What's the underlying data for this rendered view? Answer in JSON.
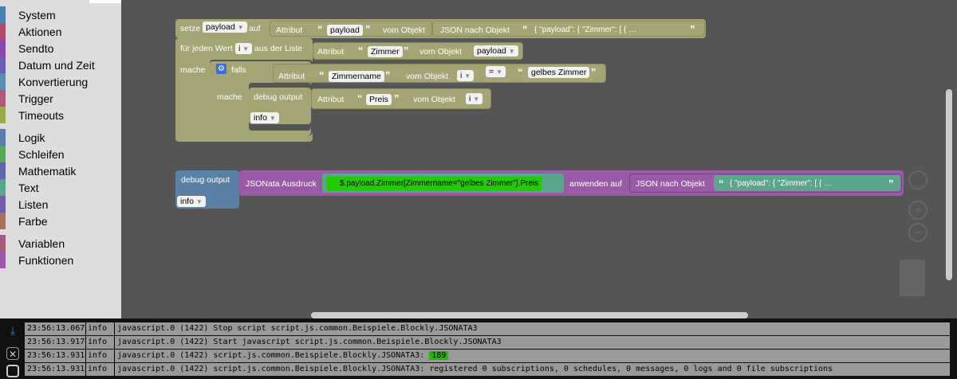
{
  "sidebar": {
    "groups1": [
      {
        "label": "System",
        "color": "#4a7fb0"
      },
      {
        "label": "Aktionen",
        "color": "#b04a6a"
      },
      {
        "label": "Sendto",
        "color": "#8a4aa8"
      },
      {
        "label": "Datum und Zeit",
        "color": "#6a5cb0"
      },
      {
        "label": "Konvertierung",
        "color": "#5a8fb0"
      },
      {
        "label": "Trigger",
        "color": "#b05a7a"
      },
      {
        "label": "Timeouts",
        "color": "#9aaa4a"
      }
    ],
    "groups2": [
      {
        "label": "Logik",
        "color": "#5b80a5"
      },
      {
        "label": "Schleifen",
        "color": "#5ba55b"
      },
      {
        "label": "Mathematik",
        "color": "#5b67a5"
      },
      {
        "label": "Text",
        "color": "#5ba58c"
      },
      {
        "label": "Listen",
        "color": "#745ba5"
      },
      {
        "label": "Farbe",
        "color": "#a5745b"
      }
    ],
    "groups3": [
      {
        "label": "Variablen",
        "color": "#a55b80"
      },
      {
        "label": "Funktionen",
        "color": "#995ba5"
      }
    ]
  },
  "blocks": {
    "set": {
      "label": "setze",
      "var": "payload",
      "auf": "auf",
      "attr": "Attribut",
      "attr_val": "payload",
      "vom": "vom Objekt",
      "json": "JSON nach Objekt",
      "json_val": "{  \"payload\": {     \"Zimmer\": [       {          …"
    },
    "foreach": {
      "label": "für jeden Wert",
      "var": "i",
      "list": "aus der Liste",
      "attr": "Attribut",
      "attr_val": "Zimmer",
      "vom": "vom Objekt",
      "obj": "payload"
    },
    "do": {
      "label": "mache"
    },
    "if": {
      "label": "falls",
      "attr": "Attribut",
      "attr_val": "Zimmername",
      "vom": "vom Objekt",
      "obj": "i",
      "op": "=",
      "val": "gelbes Zimmer"
    },
    "inner_do": {
      "label": "mache"
    },
    "debug1": {
      "label": "debug output",
      "attr": "Attribut",
      "attr_val": "Preis",
      "vom": "vom Objekt",
      "obj": "i",
      "level": "info"
    },
    "debug2": {
      "label": "debug output",
      "level": "info",
      "jsonata": "JSONata Ausdruck",
      "expr": "$.payload.Zimmer[Zimmername=\"gelbes Zimmer\"].Preis",
      "apply": "anwenden auf",
      "json": "JSON nach Objekt",
      "json_val": "{  \"payload\": {     \"Zimmer\": [       {          …"
    }
  },
  "console": {
    "rows": [
      {
        "time": "23:56:13.067",
        "level": "info",
        "msg": "javascript.0 (1422) Stop script script.js.common.Beispiele.Blockly.JSONATA3"
      },
      {
        "time": "23:56:13.917",
        "level": "info",
        "msg": "javascript.0 (1422) Start javascript script.js.common.Beispiele.Blockly.JSONATA3"
      },
      {
        "time": "23:56:13.931",
        "level": "info",
        "msg": "javascript.0 (1422) script.js.common.Beispiele.Blockly.JSONATA3: ",
        "hl": "189"
      },
      {
        "time": "23:56:13.931",
        "level": "info",
        "msg": "javascript.0 (1422) script.js.common.Beispiele.Blockly.JSONATA3: registered 0 subscriptions, 0 schedules, 0 messages, 0 logs and 0 file subscriptions"
      }
    ]
  }
}
